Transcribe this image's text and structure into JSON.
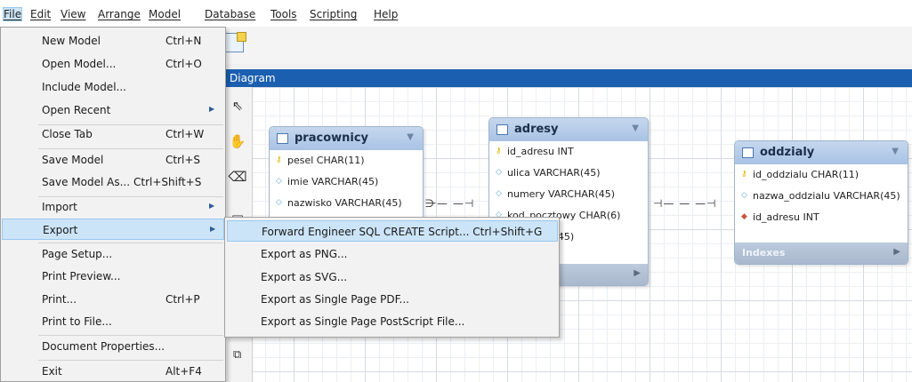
{
  "menubar": {
    "items": [
      "File",
      "Edit",
      "View",
      "Arrange",
      "Model",
      "Database",
      "Tools",
      "Scripting",
      "Help"
    ]
  },
  "diagram": {
    "tab_label": "Diagram",
    "entities": {
      "pracownicy": {
        "title": "pracownicy",
        "columns": [
          "pesel CHAR(11)",
          "imie VARCHAR(45)",
          "nazwisko VARCHAR(45)"
        ]
      },
      "adresy": {
        "title": "adresy",
        "columns": [
          "id_adresu INT",
          "ulica VARCHAR(45)",
          "numery VARCHAR(45)",
          "kod_pocztowy CHAR(6)",
          "VARCHAR(45)"
        ]
      },
      "oddzialy": {
        "title": "oddzialy",
        "columns": [
          "id_oddzialu CHAR(11)",
          "nazwa_oddzialu VARCHAR(45)",
          "id_adresu INT"
        ],
        "footer": "Indexes"
      }
    }
  },
  "file_menu": {
    "items": [
      {
        "label": "New Model",
        "shortcut": "Ctrl+N"
      },
      {
        "label": "Open Model...",
        "shortcut": "Ctrl+O"
      },
      {
        "label": "Include Model...",
        "shortcut": ""
      },
      {
        "label": "Open Recent",
        "shortcut": ""
      },
      {
        "label": "Close Tab",
        "shortcut": "Ctrl+W"
      },
      {
        "label": "Save Model",
        "shortcut": "Ctrl+S"
      },
      {
        "label": "Save Model As...",
        "shortcut": "Ctrl+Shift+S"
      },
      {
        "label": "Import",
        "shortcut": ""
      },
      {
        "label": "Export",
        "shortcut": ""
      },
      {
        "label": "Page Setup...",
        "shortcut": ""
      },
      {
        "label": "Print Preview...",
        "shortcut": ""
      },
      {
        "label": "Print...",
        "shortcut": "Ctrl+P"
      },
      {
        "label": "Print to File...",
        "shortcut": ""
      },
      {
        "label": "Document Properties...",
        "shortcut": ""
      },
      {
        "label": "Exit",
        "shortcut": "Alt+F4"
      }
    ]
  },
  "export_submenu": {
    "items": [
      {
        "label": "Forward Engineer SQL CREATE Script... Ctrl+Shift+G"
      },
      {
        "label": "Export as PNG..."
      },
      {
        "label": "Export as SVG..."
      },
      {
        "label": "Export as Single Page PDF..."
      },
      {
        "label": "Export as Single Page PostScript File..."
      }
    ]
  },
  "colors": {
    "menu_highlight": "#cce4f7",
    "diagram_tab": "#1b5fb0",
    "entity_header": "#a9c3e4"
  }
}
